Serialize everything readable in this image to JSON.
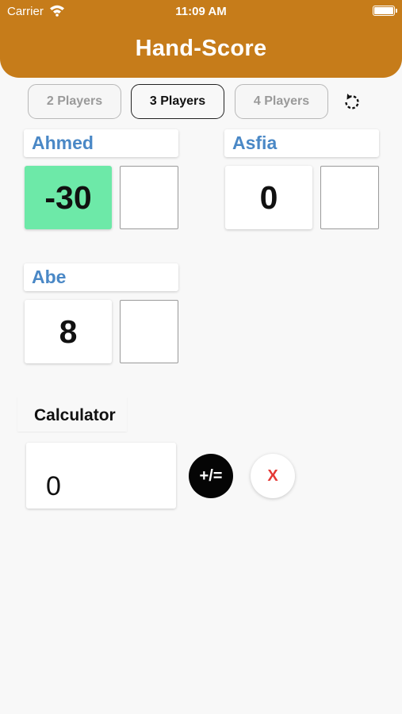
{
  "status_bar": {
    "carrier": "Carrier",
    "time": "11:09 AM",
    "wifi_icon": "wifi-icon",
    "battery_icon": "battery-icon"
  },
  "header": {
    "title": "Hand-Score",
    "color": "#c67c1a"
  },
  "tabs": [
    {
      "label": "2 Players",
      "selected": false
    },
    {
      "label": "3 Players",
      "selected": true
    },
    {
      "label": "4 Players",
      "selected": false
    }
  ],
  "reset_icon": "refresh-icon",
  "players": [
    {
      "name": "Ahmed",
      "score": "-30",
      "entry": "",
      "leader": true
    },
    {
      "name": "Asfia",
      "score": "0",
      "entry": "",
      "leader": false
    },
    {
      "name": "Abe",
      "score": "8",
      "entry": "",
      "leader": false
    }
  ],
  "calculator": {
    "title": "Calculator",
    "display": "0",
    "sign_label": "+/=",
    "clear_label": "X"
  },
  "colors": {
    "leader": "#6de9a8",
    "player_name": "#4a88c6",
    "clear": "#e53935",
    "background": "#f8f8f8"
  }
}
